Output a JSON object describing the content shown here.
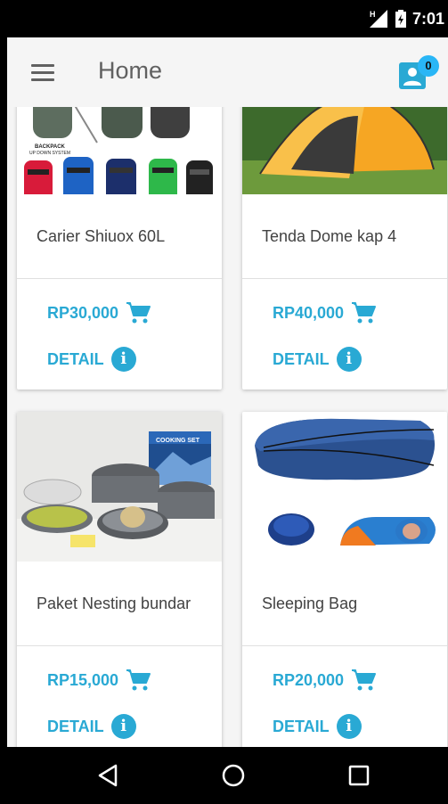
{
  "status_bar": {
    "time": "7:01",
    "network_label": "H"
  },
  "app_bar": {
    "title": "Home",
    "cart_count": "0"
  },
  "products": [
    {
      "name": "Carier Shiuox 60L",
      "price": "RP30,000",
      "detail_label": "DETAIL"
    },
    {
      "name": "Tenda Dome kap 4",
      "price": "RP40,000",
      "detail_label": "DETAIL"
    },
    {
      "name": "Paket Nesting bundar",
      "price": "RP15,000",
      "detail_label": "DETAIL"
    },
    {
      "name": "Sleeping Bag",
      "price": "RP20,000",
      "detail_label": "DETAIL"
    }
  ],
  "image_text": {
    "backpack_caption": "BACKPACK",
    "backpack_caption2": "UP DOWN SYSTEM",
    "cooking_set_box": "COOKING SET"
  },
  "colors": {
    "accent": "#29a9d4",
    "badge": "#29b6f6",
    "app_bar": "#f5f5f5"
  }
}
